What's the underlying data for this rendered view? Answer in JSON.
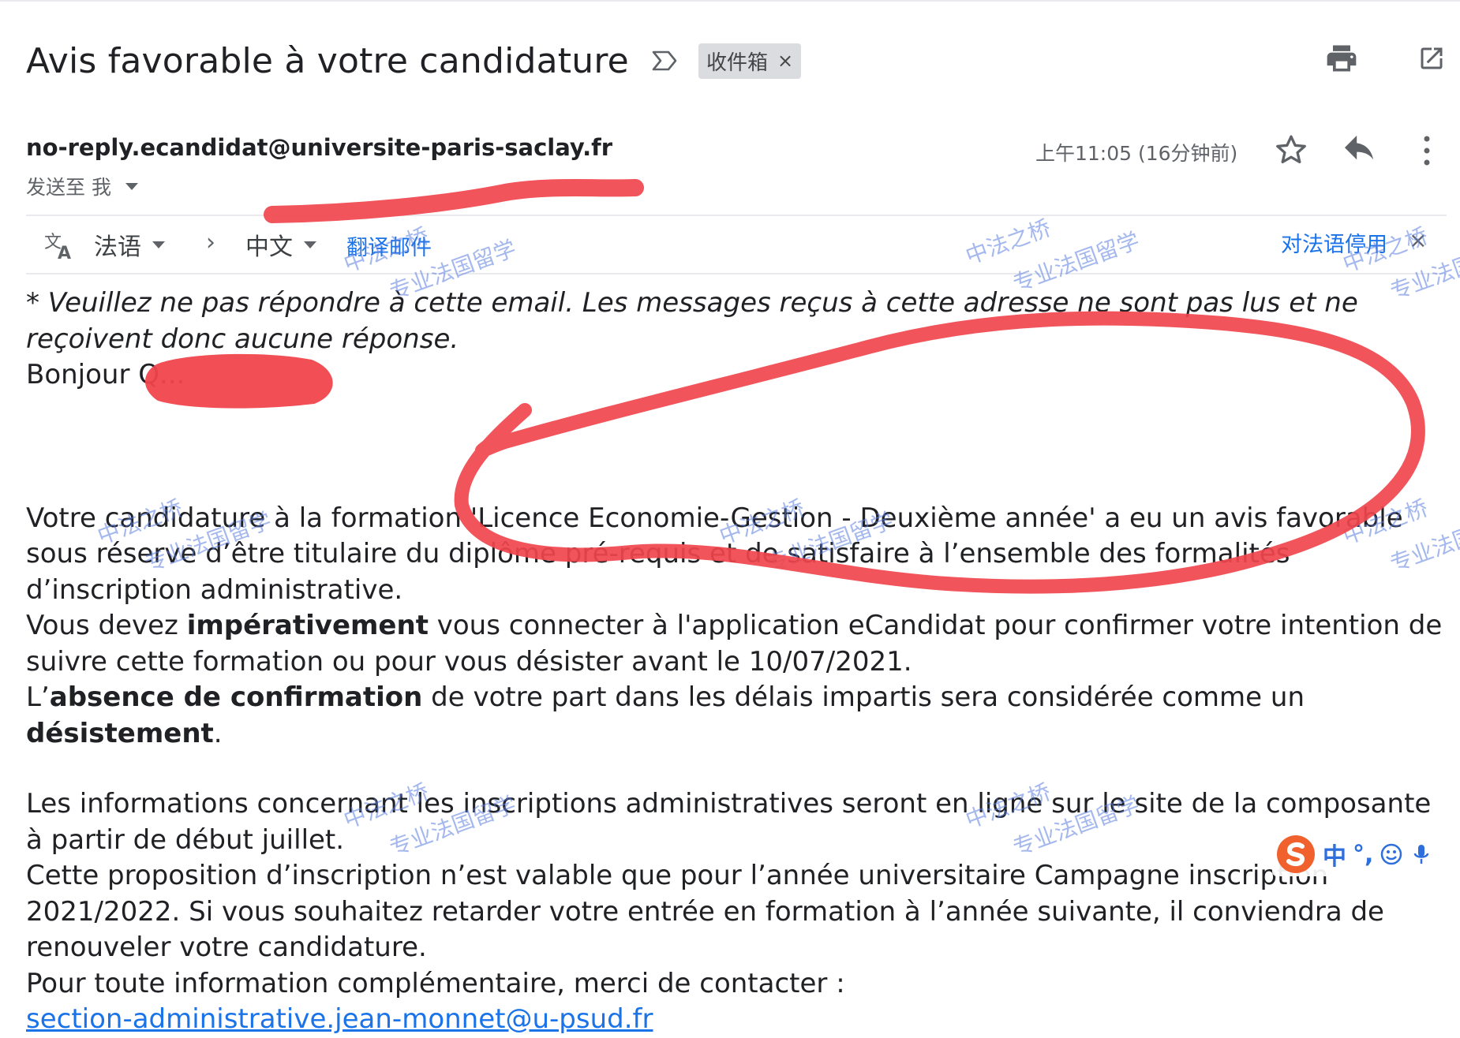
{
  "email": {
    "subject": "Avis favorable à votre candidature",
    "label": "收件箱",
    "label_close": "×",
    "sender": "no-reply.ecandidat@universite-paris-saclay.fr",
    "to_text": "发送至 我",
    "timestamp": "上午11:05 (16分钟前)"
  },
  "translate_bar": {
    "source_lang": "法语",
    "arrow": "›",
    "target_lang": "中文",
    "translate_link": "翻译邮件",
    "disable_link": "对法语停用",
    "close": "×"
  },
  "body": {
    "notice": "* Veuillez ne pas répondre à cette email. Les messages reçus à cette adresse ne sont pas lus et ne reçoivent donc aucune réponse.",
    "greeting": "Bonjour Q...",
    "p1": "Votre candidature à la formation 'Licence Economie-Gestion - Deuxième année' a eu un avis favorable sous réserve d’être titulaire du diplôme pré-requis et de satisfaire à l’ensemble des formalités d’inscription administrative.",
    "p2_pre": "Vous devez ",
    "p2_bold": "impérativement",
    "p2_post": " vous connecter à l'application eCandidat pour confirmer votre intention de suivre cette formation ou pour vous désister avant le 10/07/2021.",
    "p3_pre": "L’",
    "p3_bold1": "absence de confirmation",
    "p3_mid": " de votre part dans les délais impartis sera considérée comme un ",
    "p3_bold2": "désistement",
    "p3_post": ".",
    "p4": "Les informations concernant les inscriptions administratives seront en ligne sur le site de la composante à partir de début juillet.",
    "p5": "Cette proposition d’inscription n’est valable que pour l’année universitaire Campagne inscription 2021/2022. Si vous souhaitez retarder votre entrée en formation à l’année suivante, il conviendra de renouveler votre candidature.",
    "p6": "Pour toute information complémentaire, merci de contacter :",
    "contact_email": "section-administrative.jean-monnet@u-psud.fr"
  },
  "watermarks": [
    {
      "line1": "中法之桥",
      "line2": "专业法国留学"
    },
    {
      "line1": "中法之桥",
      "line2": "专业法国留学"
    },
    {
      "line1": "中法之桥",
      "line2": "专业法国留学"
    },
    {
      "line1": "中法之桥",
      "line2": "专业法国留学"
    },
    {
      "line1": "中法之桥",
      "line2": "专业法国留学"
    },
    {
      "line1": "中法之桥",
      "line2": "专业法国留学"
    },
    {
      "line1": "中法之桥",
      "line2": "专业法国留学"
    },
    {
      "line1": "中法之桥",
      "line2": "专业法国留学"
    }
  ],
  "ime_toolbar": {
    "mode": "中",
    "punct": "°,"
  },
  "colors": {
    "link": "#1a73e8",
    "annotation_red": "#f0454c",
    "watermark": "#5b7fe0"
  }
}
